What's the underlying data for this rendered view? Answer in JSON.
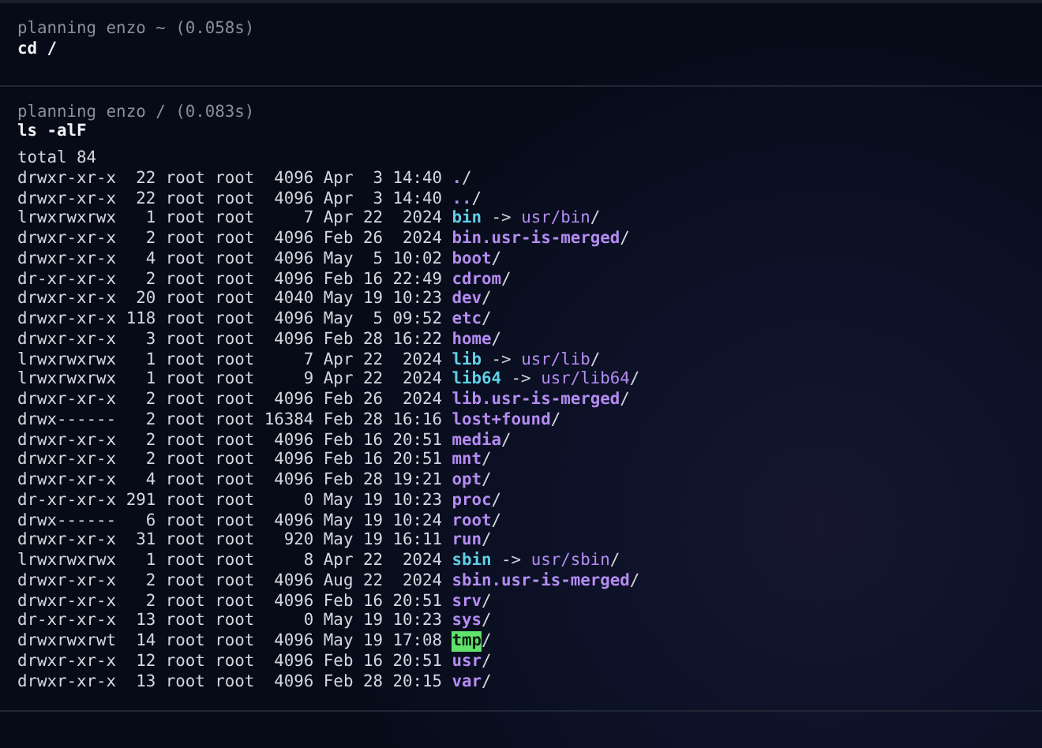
{
  "blocks": [
    {
      "prompt": "planning enzo ~ (0.058s)",
      "command": "cd /"
    },
    {
      "prompt": "planning enzo / (0.083s)",
      "command": "ls -alF",
      "total": "total 84",
      "output": [
        {
          "meta": "drwxr-xr-x  22 root root  4096 Apr  3 14:40",
          "kind": "dir",
          "name": ".",
          "suffix": "/"
        },
        {
          "meta": "drwxr-xr-x  22 root root  4096 Apr  3 14:40",
          "kind": "dir",
          "name": "..",
          "suffix": "/"
        },
        {
          "meta": "lrwxrwxrwx   1 root root     7 Apr 22  2024",
          "kind": "link",
          "name": "bin",
          "arrow": "->",
          "target": "usr/bin",
          "suffix": "/"
        },
        {
          "meta": "drwxr-xr-x   2 root root  4096 Feb 26  2024",
          "kind": "dir",
          "name": "bin.usr-is-merged",
          "suffix": "/"
        },
        {
          "meta": "drwxr-xr-x   4 root root  4096 May  5 10:02",
          "kind": "dir",
          "name": "boot",
          "suffix": "/"
        },
        {
          "meta": "dr-xr-xr-x   2 root root  4096 Feb 16 22:49",
          "kind": "dir",
          "name": "cdrom",
          "suffix": "/"
        },
        {
          "meta": "drwxr-xr-x  20 root root  4040 May 19 10:23",
          "kind": "dir",
          "name": "dev",
          "suffix": "/"
        },
        {
          "meta": "drwxr-xr-x 118 root root  4096 May  5 09:52",
          "kind": "dir",
          "name": "etc",
          "suffix": "/"
        },
        {
          "meta": "drwxr-xr-x   3 root root  4096 Feb 28 16:22",
          "kind": "dir",
          "name": "home",
          "suffix": "/"
        },
        {
          "meta": "lrwxrwxrwx   1 root root     7 Apr 22  2024",
          "kind": "link",
          "name": "lib",
          "arrow": "->",
          "target": "usr/lib",
          "suffix": "/"
        },
        {
          "meta": "lrwxrwxrwx   1 root root     9 Apr 22  2024",
          "kind": "link",
          "name": "lib64",
          "arrow": "->",
          "target": "usr/lib64",
          "suffix": "/"
        },
        {
          "meta": "drwxr-xr-x   2 root root  4096 Feb 26  2024",
          "kind": "dir",
          "name": "lib.usr-is-merged",
          "suffix": "/"
        },
        {
          "meta": "drwx------   2 root root 16384 Feb 28 16:16",
          "kind": "dir",
          "name": "lost+found",
          "suffix": "/"
        },
        {
          "meta": "drwxr-xr-x   2 root root  4096 Feb 16 20:51",
          "kind": "dir",
          "name": "media",
          "suffix": "/"
        },
        {
          "meta": "drwxr-xr-x   2 root root  4096 Feb 16 20:51",
          "kind": "dir",
          "name": "mnt",
          "suffix": "/"
        },
        {
          "meta": "drwxr-xr-x   4 root root  4096 Feb 28 19:21",
          "kind": "dir",
          "name": "opt",
          "suffix": "/"
        },
        {
          "meta": "dr-xr-xr-x 291 root root     0 May 19 10:23",
          "kind": "dir",
          "name": "proc",
          "suffix": "/"
        },
        {
          "meta": "drwx------   6 root root  4096 May 19 10:24",
          "kind": "dir",
          "name": "root",
          "suffix": "/"
        },
        {
          "meta": "drwxr-xr-x  31 root root   920 May 19 16:11",
          "kind": "dir",
          "name": "run",
          "suffix": "/"
        },
        {
          "meta": "lrwxrwxrwx   1 root root     8 Apr 22  2024",
          "kind": "link",
          "name": "sbin",
          "arrow": "->",
          "target": "usr/sbin",
          "suffix": "/"
        },
        {
          "meta": "drwxr-xr-x   2 root root  4096 Aug 22  2024",
          "kind": "dir",
          "name": "sbin.usr-is-merged",
          "suffix": "/"
        },
        {
          "meta": "drwxr-xr-x   2 root root  4096 Feb 16 20:51",
          "kind": "dir",
          "name": "srv",
          "suffix": "/"
        },
        {
          "meta": "dr-xr-xr-x  13 root root     0 May 19 10:23",
          "kind": "dir",
          "name": "sys",
          "suffix": "/"
        },
        {
          "meta": "drwxrwxrwt  14 root root  4096 May 19 17:08",
          "kind": "sticky",
          "name": "tmp",
          "suffix": "/"
        },
        {
          "meta": "drwxr-xr-x  12 root root  4096 Feb 16 20:51",
          "kind": "dir",
          "name": "usr",
          "suffix": "/"
        },
        {
          "meta": "drwxr-xr-x  13 root root  4096 Feb 28 20:15",
          "kind": "dir",
          "name": "var",
          "suffix": "/"
        }
      ]
    }
  ]
}
